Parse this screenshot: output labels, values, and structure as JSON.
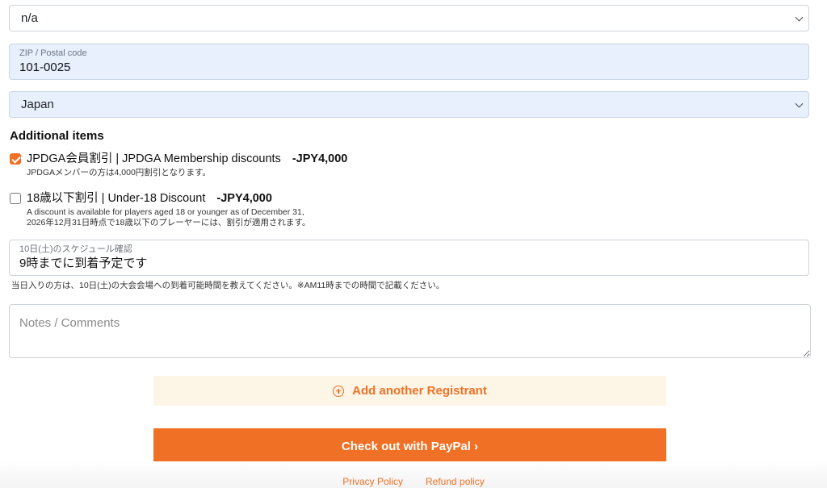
{
  "form": {
    "state_select": {
      "value": "n/a"
    },
    "zip": {
      "label": "ZIP / Postal code",
      "value": "101-0025"
    },
    "country_select": {
      "value": "Japan"
    },
    "additional_items": {
      "title": "Additional items",
      "items": [
        {
          "title": "JPDGA会員割引 | JPDGA Membership discounts",
          "price": "-JPY4,000",
          "desc_lines": [
            "JPDGAメンバーの方は4,000円割引となります。"
          ],
          "checked": true
        },
        {
          "title": "18歳以下割引 | Under-18 Discount",
          "price": "-JPY4,000",
          "desc_lines": [
            "A discount is available for players aged 18 or younger as of December 31,",
            "2026年12月31日時点で18歳以下のプレーヤーには、割引が適用されます。"
          ],
          "checked": false
        }
      ]
    },
    "schedule": {
      "label": "10日(土)のスケジュール確認",
      "value": "9時までに到着予定です",
      "help": "当日入りの方は、10日(土)の大会会場への到着可能時間を教えてください。※AM11時までの時間で記載ください。"
    },
    "notes": {
      "placeholder": "Notes / Comments"
    },
    "add_registrant_label": "Add another Registrant",
    "checkout_label": "Check out with PayPal ›"
  },
  "footer": {
    "privacy_label": "Privacy Policy",
    "refund_label": "Refund policy"
  },
  "colors": {
    "accent": "#f07125",
    "autofill_bg": "#e8f0fe",
    "add_button_bg": "#fdf5e6"
  },
  "icons": {
    "select_chevron": "chevron-down-icon",
    "add_registrant": "plus-circle-icon",
    "checkbox_checked": "checkmark-icon"
  }
}
